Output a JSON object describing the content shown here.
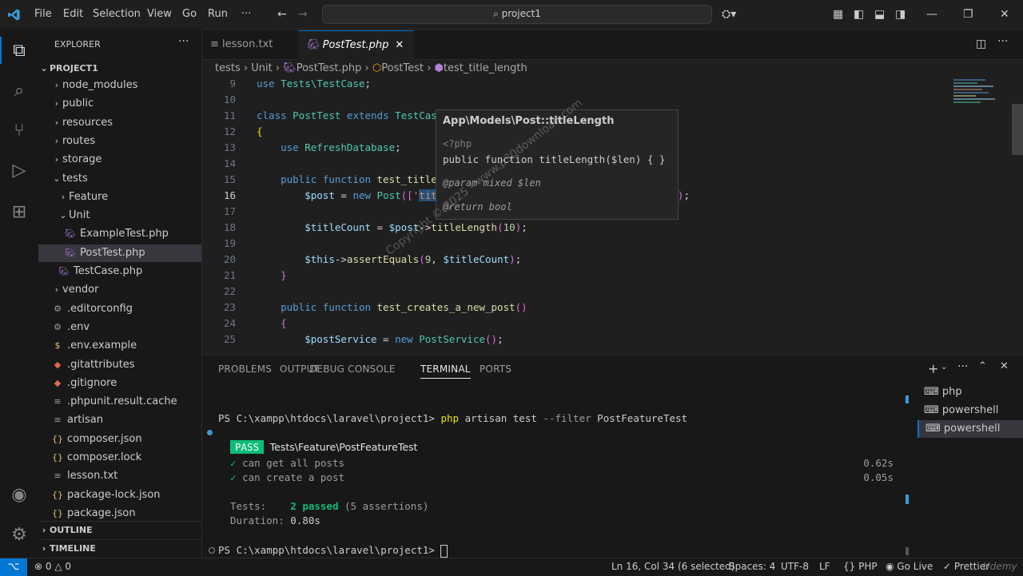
{
  "menu": [
    "File",
    "Edit",
    "Selection",
    "View",
    "Go",
    "Run",
    "···"
  ],
  "search": "project1",
  "explorer": {
    "title": "EXPLORER",
    "project": "PROJECT1",
    "items": [
      {
        "label": "node_modules",
        "type": "folder-closed",
        "indent": 1
      },
      {
        "label": "public",
        "type": "folder-closed",
        "indent": 1
      },
      {
        "label": "resources",
        "type": "folder-closed",
        "indent": 1
      },
      {
        "label": "routes",
        "type": "folder-closed",
        "indent": 1
      },
      {
        "label": "storage",
        "type": "folder-closed",
        "indent": 1
      },
      {
        "label": "tests",
        "type": "folder-open",
        "indent": 1
      },
      {
        "label": "Feature",
        "type": "folder-closed",
        "indent": 2
      },
      {
        "label": "Unit",
        "type": "folder-open",
        "indent": 2
      },
      {
        "label": "ExampleTest.php",
        "type": "php",
        "indent": 3
      },
      {
        "label": "PostTest.php",
        "type": "php",
        "indent": 3,
        "selected": true
      },
      {
        "label": "TestCase.php",
        "type": "php",
        "indent": 2
      },
      {
        "label": "vendor",
        "type": "folder-closed",
        "indent": 1
      },
      {
        "label": ".editorconfig",
        "type": "gear",
        "indent": 1
      },
      {
        "label": ".env",
        "type": "gear",
        "indent": 1
      },
      {
        "label": ".env.example",
        "type": "dollar",
        "indent": 1
      },
      {
        "label": ".gitattributes",
        "type": "git",
        "indent": 1
      },
      {
        "label": ".gitignore",
        "type": "git",
        "indent": 1
      },
      {
        "label": ".phpunit.result.cache",
        "type": "lines",
        "indent": 1
      },
      {
        "label": "artisan",
        "type": "lines",
        "indent": 1
      },
      {
        "label": "composer.json",
        "type": "json",
        "indent": 1
      },
      {
        "label": "composer.lock",
        "type": "json",
        "indent": 1
      },
      {
        "label": "lesson.txt",
        "type": "lines",
        "indent": 1
      },
      {
        "label": "package-lock.json",
        "type": "json",
        "indent": 1
      },
      {
        "label": "package.json",
        "type": "json",
        "indent": 1
      }
    ],
    "outline": "OUTLINE",
    "timeline": "TIMELINE"
  },
  "tabs": [
    {
      "label": "lesson.txt",
      "active": false
    },
    {
      "label": "PostTest.php",
      "active": true
    }
  ],
  "breadcrumb": [
    "tests",
    "Unit",
    "PostTest.php",
    "PostTest",
    "test_title_length"
  ],
  "code_lines": [
    9,
    10,
    11,
    12,
    13,
    14,
    15,
    16,
    17,
    18,
    19,
    20,
    21,
    22,
    23,
    24,
    25
  ],
  "hover": {
    "title": "App\\Models\\Post::titleLength",
    "tag": "<?php",
    "signature": "public function titleLength($len) { }",
    "param": "@param  mixed $len",
    "return": "@return  bool"
  },
  "watermark": "Copyright © 2025 - www.p30download.com",
  "panel": {
    "tabs": [
      "PROBLEMS",
      "OUTPUT",
      "DEBUG CONSOLE",
      "TERMINAL",
      "PORTS"
    ],
    "active_tab": "TERMINAL",
    "terminal": {
      "prompt1": "PS C:\\xampp\\htdocs\\laravel\\project1>",
      "command": "php artisan test --filter PostFeatureTest",
      "pass": "PASS",
      "suite": "Tests\\Feature\\PostFeatureTest",
      "tests": [
        {
          "name": "can get all posts",
          "time": "0.62s"
        },
        {
          "name": "can create a post",
          "time": "0.05s"
        }
      ],
      "tests_label": "Tests:",
      "passed": "2 passed",
      "assertions": "(5 assertions)",
      "duration_label": "Duration:",
      "duration": "0.80s",
      "prompt2": "PS C:\\xampp\\htdocs\\laravel\\project1>"
    },
    "terminal_list": [
      "php",
      "powershell",
      "powershell"
    ]
  },
  "status": {
    "errors": "0",
    "warnings": "0",
    "position": "Ln 16, Col 34 (6 selected)",
    "spaces": "Spaces: 4",
    "encoding": "UTF-8",
    "eol": "LF",
    "language": "PHP",
    "golive": "Go Live",
    "prettier": "Prettier"
  },
  "brand": "Udemy"
}
